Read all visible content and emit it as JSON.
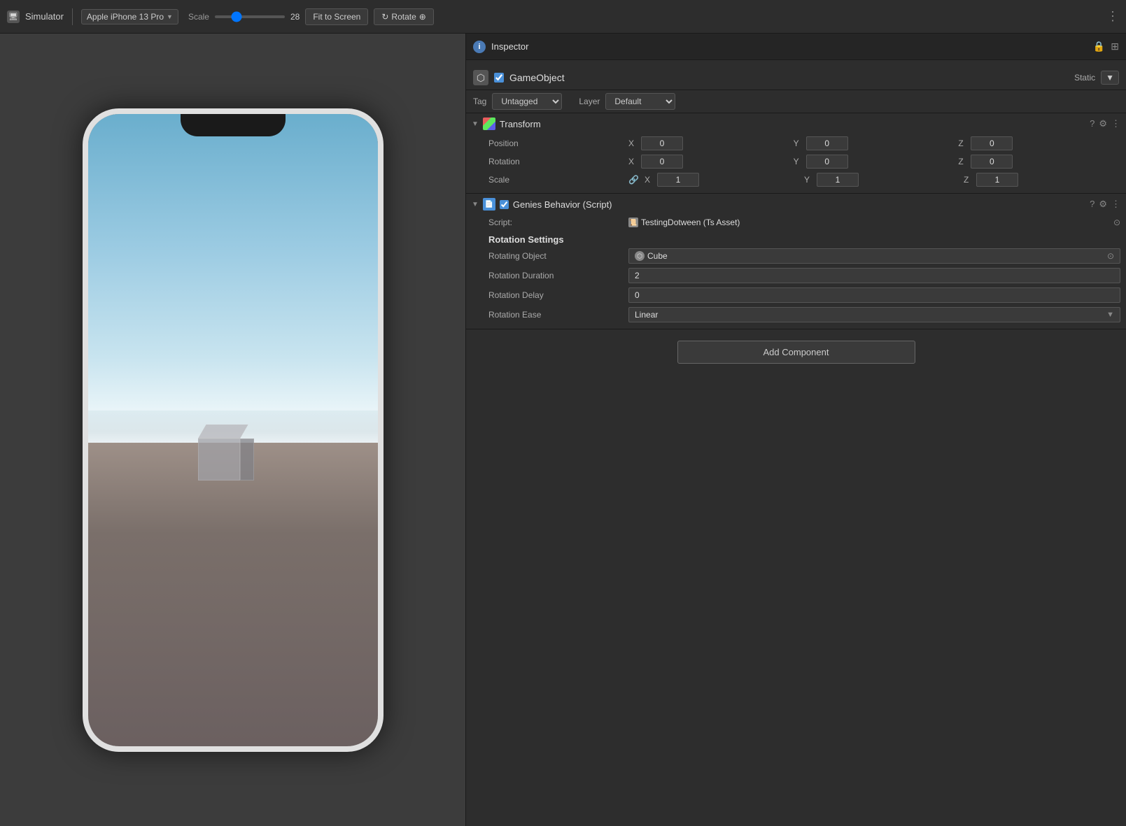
{
  "topbar": {
    "title": "Simulator",
    "device_label": "Apple iPhone 13 Pro",
    "scale_label": "Scale",
    "scale_value": "28",
    "fit_to_screen": "Fit to Screen",
    "rotate": "Rotate"
  },
  "inspector": {
    "title": "Inspector",
    "gameobject": {
      "name": "GameObject",
      "static_label": "Static",
      "tag_label": "Tag",
      "tag_value": "Untagged",
      "layer_label": "Layer",
      "layer_value": "Default"
    },
    "transform": {
      "title": "Transform",
      "position_label": "Position",
      "rotation_label": "Rotation",
      "scale_label": "Scale",
      "position": {
        "x": "0",
        "y": "0",
        "z": "0"
      },
      "rotation": {
        "x": "0",
        "y": "0",
        "z": "0"
      },
      "scale": {
        "x": "1",
        "y": "1",
        "z": "1"
      }
    },
    "script": {
      "title": "Genies Behavior (Script)",
      "script_label": "Script:",
      "script_name": "TestingDotween (Ts Asset)"
    },
    "rotation_settings": {
      "heading": "Rotation Settings",
      "rotating_object_label": "Rotating Object",
      "rotating_object_value": "Cube",
      "rotation_duration_label": "Rotation Duration",
      "rotation_duration_value": "2",
      "rotation_delay_label": "Rotation Delay",
      "rotation_delay_value": "0",
      "rotation_ease_label": "Rotation Ease",
      "rotation_ease_value": "Linear"
    },
    "add_component_label": "Add Component"
  }
}
